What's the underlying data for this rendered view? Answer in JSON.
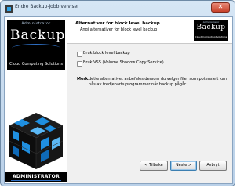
{
  "window": {
    "title": "Endre Backup-jobb veiviser"
  },
  "sidebar": {
    "logo": {
      "top_text": "Administrator",
      "brand": "Backup",
      "tagline": "Cloud Computing Solutions"
    },
    "footer_text": "ADMINISTRATOR"
  },
  "header": {
    "title": "Alternativer for block level backup",
    "subtitle": "Angi alternativer for block level backup",
    "logo": {
      "top_text": "Administrator",
      "brand": "Backup",
      "tagline": "Cloud Computing Solutions"
    }
  },
  "options": [
    {
      "label": "Bruk block level backup",
      "checked": false
    },
    {
      "label": "Bruk VSS (Volume Shadow Copy Service)",
      "checked": false
    }
  ],
  "note": {
    "label": "Merk:",
    "text": "dette alternativet anbefales dersom du velger filer som potensielt kan nås av tredjeparts programmer når backup pågår"
  },
  "buttons": {
    "back": "< Tilbake",
    "next": "Neste >",
    "cancel": "Avbryt"
  },
  "colors": {
    "accent_blue": "#2e6fc4",
    "cube_black": "#111111",
    "cube_blue": "#1f8fe0"
  }
}
